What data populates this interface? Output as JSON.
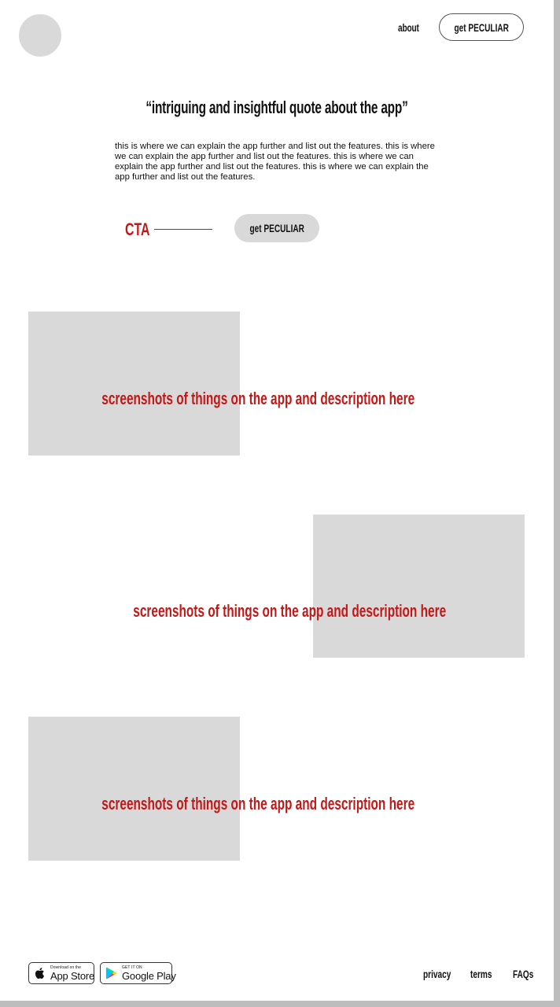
{
  "header": {
    "about_label": "about",
    "cta_label": "get PECULIAR"
  },
  "hero": {
    "quote": "“intriguing and insightful quote about the app”",
    "description": "this is where we can explain the app further and list out the features. this is where we can explain the app further and list out the features. this is where we can explain the app further and list out the features. this is where we can explain the app further and list out the features."
  },
  "cta": {
    "label": "CTA",
    "button_label": "get PECULIAR"
  },
  "features": [
    {
      "text": "screenshots of things on the app and description here"
    },
    {
      "text": "screenshots of things on the app and description here"
    },
    {
      "text": "screenshots of things on the app and description here"
    }
  ],
  "footer": {
    "app_store": {
      "small": "Download on the",
      "big": "App Store"
    },
    "google_play": {
      "small": "GET IT ON",
      "big": "Google Play"
    },
    "links": [
      "privacy",
      "terms",
      "FAQs"
    ]
  },
  "colors": {
    "accent": "#c21818",
    "placeholder": "#d9d9d9",
    "text": "#111111"
  }
}
